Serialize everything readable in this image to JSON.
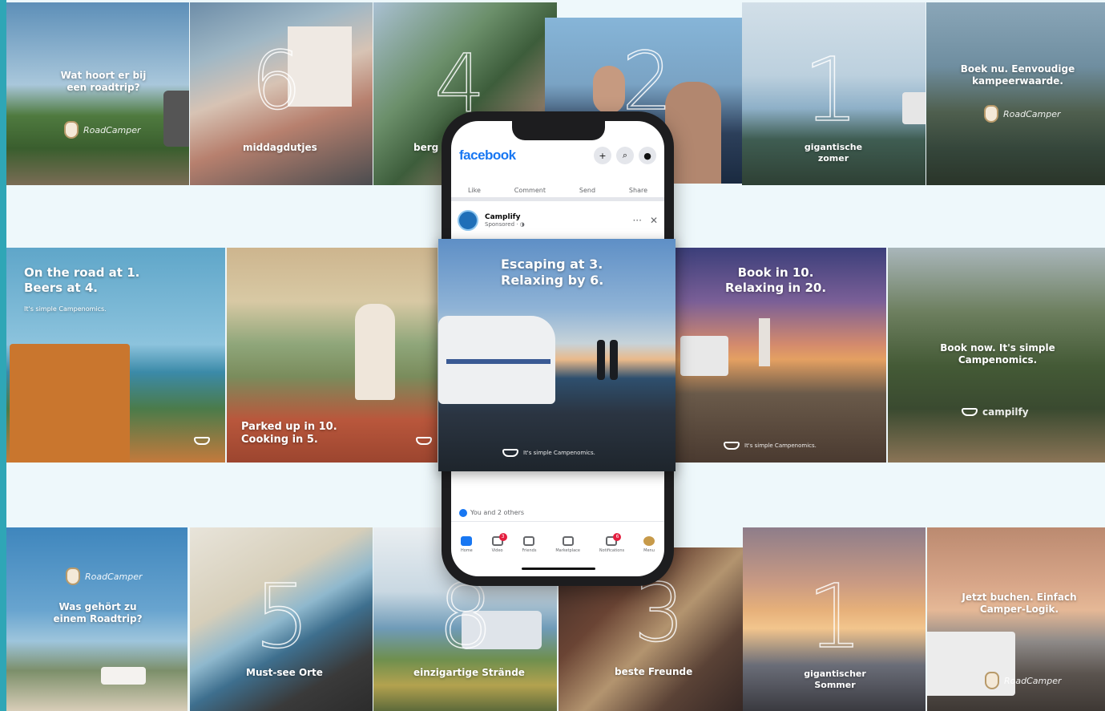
{
  "row1": [
    {
      "caption": "Wat hoort er bij een roadtrip?",
      "logo": "RoadCamper"
    },
    {
      "number": "6",
      "caption": "middagdutjes"
    },
    {
      "number": "4",
      "caption": "berg"
    },
    {
      "number": "2",
      "caption": ""
    },
    {
      "number": "1",
      "caption": "gigantische zomer"
    },
    {
      "caption": "Boek nu. Eenvoudige kampeerwaarde.",
      "logo": "RoadCamper"
    }
  ],
  "row2": [
    {
      "caption": "On the road at 1. Beers at 4.",
      "subcaption": "It's simple Campenomics."
    },
    {
      "caption": "Parked up in 10. Cooking in 5."
    },
    {
      "caption": "Book in 10. Relaxing in 20.",
      "footer": "It's simple Campenomics."
    },
    {
      "caption": "Book now. It's simple Campenomics.",
      "logo": "campilfy"
    }
  ],
  "row3": [
    {
      "caption": "Was gehört zu einem Roadtrip?",
      "logo": "RoadCamper"
    },
    {
      "number": "5",
      "caption": "Must-see Orte"
    },
    {
      "number": "8",
      "caption": "einzigartige Strände"
    },
    {
      "number": "3",
      "caption": "beste Freunde"
    },
    {
      "number": "1",
      "caption": "gigantischer Sommer"
    },
    {
      "caption": "Jetzt buchen. Einfach Camper-Logik.",
      "logo": "RoadCamper"
    }
  ],
  "phone": {
    "app_logo": "facebook",
    "actions": [
      "Like",
      "Comment",
      "Send",
      "Share"
    ],
    "post_author": "Camplify",
    "post_meta": "Sponsored · ◑",
    "likes_text": "You and 2 others",
    "tabs": [
      {
        "label": "Home",
        "badge": ""
      },
      {
        "label": "Video",
        "badge": "3"
      },
      {
        "label": "Friends",
        "badge": ""
      },
      {
        "label": "Marketplace",
        "badge": ""
      },
      {
        "label": "Notifications",
        "badge": "6"
      },
      {
        "label": "Menu",
        "badge": ""
      }
    ]
  },
  "featured": {
    "caption": "Escaping at 3. Relaxing by 6.",
    "footer": "It's simple Campenomics."
  },
  "colors": {
    "accent_strip": "#2fa6b6",
    "facebook_blue": "#1877f2",
    "background": "#eef8fb"
  }
}
